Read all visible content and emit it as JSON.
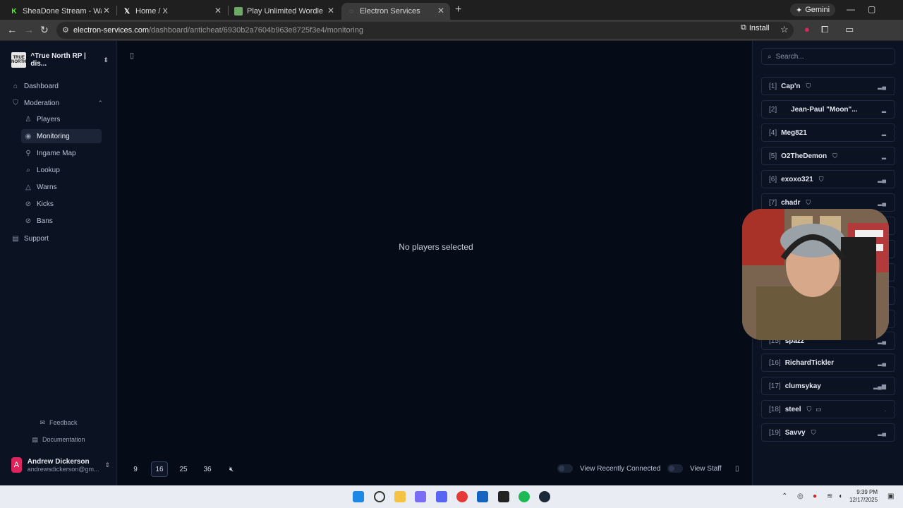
{
  "browser": {
    "tabs": [
      {
        "title": "SheaDone Stream - Watch Live",
        "icon": "kick-icon"
      },
      {
        "title": "Home / X",
        "icon": "x-icon"
      },
      {
        "title": "Play Unlimited Wordle",
        "icon": "wordle-icon"
      },
      {
        "title": "Electron Services",
        "icon": "electron-icon",
        "active": true
      }
    ],
    "gemini_label": "Gemini",
    "url_host": "electron-services.com",
    "url_path": "/dashboard/anticheat/6930b2a7604b963e8725f3e4/monitoring",
    "install_label": "Install"
  },
  "sidebar": {
    "org_name": "^True North RP | dis...",
    "org_logo_text": "TRUE NORTH",
    "items": [
      {
        "label": "Dashboard",
        "icon": "home-icon"
      },
      {
        "label": "Moderation",
        "icon": "shield-icon"
      },
      {
        "label": "Players",
        "icon": "users-icon"
      },
      {
        "label": "Monitoring",
        "icon": "eye-icon"
      },
      {
        "label": "Ingame Map",
        "icon": "map-icon"
      },
      {
        "label": "Lookup",
        "icon": "search-icon"
      },
      {
        "label": "Warns",
        "icon": "warning-icon"
      },
      {
        "label": "Kicks",
        "icon": "kick-icon"
      },
      {
        "label": "Bans",
        "icon": "ban-icon"
      },
      {
        "label": "Support",
        "icon": "book-icon"
      }
    ],
    "feedback_label": "Feedback",
    "documentation_label": "Documentation",
    "user": {
      "initial": "A",
      "name": "Andrew Dickerson",
      "email": "andrewsdickerson@gm..."
    }
  },
  "main": {
    "empty_message": "No players selected",
    "grid_options": [
      "9",
      "16",
      "25",
      "36"
    ],
    "selected_grid": "16",
    "view_recently_connected_label": "View Recently Connected",
    "view_staff_label": "View Staff"
  },
  "players_panel": {
    "search_placeholder": "Search...",
    "players": [
      {
        "id": "[1]",
        "name": "Cap'n",
        "staff": true
      },
      {
        "id": "[2]",
        "name": "Jean-Paul \"Moon\"...",
        "staff": false
      },
      {
        "id": "[4]",
        "name": "Meg821",
        "staff": false
      },
      {
        "id": "[5]",
        "name": "O2TheDemon",
        "staff": true
      },
      {
        "id": "[6]",
        "name": "exoxo321",
        "staff": true
      },
      {
        "id": "[7]",
        "name": "chadr",
        "staff": true
      },
      {
        "id": "[15]",
        "name": "spazz",
        "staff": false
      },
      {
        "id": "[16]",
        "name": "RichardTickler",
        "staff": false
      },
      {
        "id": "[17]",
        "name": "clumsykay",
        "staff": false
      },
      {
        "id": "[18]",
        "name": "steel",
        "staff": true
      },
      {
        "id": "[19]",
        "name": "Savvy",
        "staff": true
      }
    ]
  },
  "taskbar": {
    "time": "9:39 PM",
    "date": "12/17/2025"
  }
}
